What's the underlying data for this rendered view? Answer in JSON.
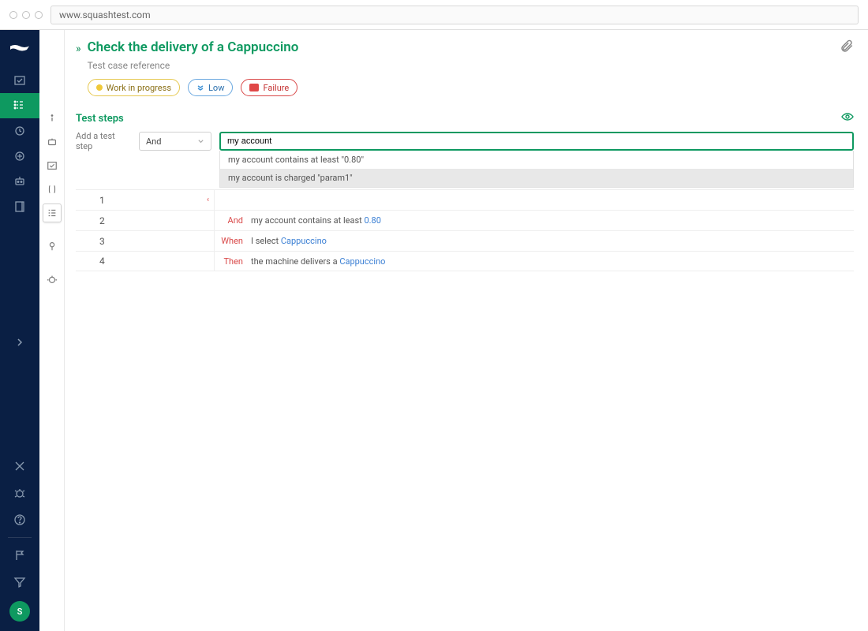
{
  "browser": {
    "url": "www.squashtest.com"
  },
  "header": {
    "title": "Check the delivery of a Cappuccino",
    "subtitle": "Test case reference"
  },
  "badges": {
    "status": "Work in progress",
    "priority": "Low",
    "exec": "Failure"
  },
  "section": {
    "title": "Test steps",
    "add_label": "Add a test step",
    "keyword_selected": "And"
  },
  "input": {
    "value": "my account"
  },
  "autocomplete": [
    {
      "text": "my account contains at least \"0.80\""
    },
    {
      "text": "my account is charged \"param1\""
    }
  ],
  "steps": [
    {
      "num": "1",
      "keyword": "",
      "text": "",
      "show_handle": true
    },
    {
      "num": "2",
      "keyword": "And",
      "kw_class": "and",
      "prefix": "my account contains at least ",
      "param": "0.80"
    },
    {
      "num": "3",
      "keyword": "When",
      "kw_class": "when",
      "prefix": "I select ",
      "param": "Cappuccino"
    },
    {
      "num": "4",
      "keyword": "Then",
      "kw_class": "then",
      "prefix": "the machine delivers a ",
      "param": "Cappuccino"
    }
  ],
  "avatar": "S"
}
